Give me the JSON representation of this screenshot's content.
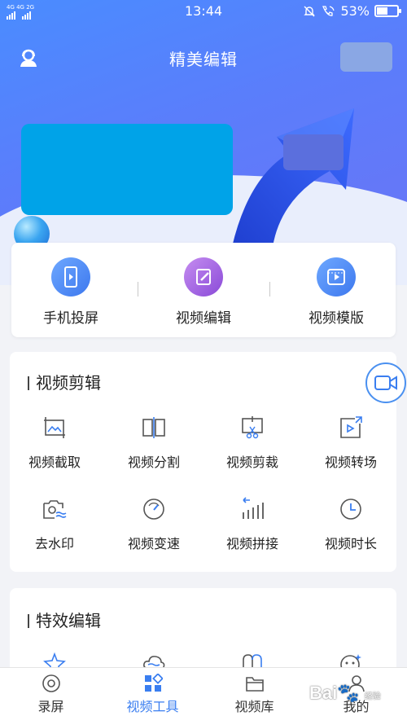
{
  "status_bar": {
    "signal_left": "4G 4G 2G",
    "time": "13:44",
    "battery": "53%"
  },
  "header": {
    "title": "精美编辑"
  },
  "quick_actions": [
    {
      "label": "手机投屏",
      "icon": "phone-cast-icon"
    },
    {
      "label": "视频编辑",
      "icon": "pencil-icon"
    },
    {
      "label": "视频模版",
      "icon": "video-template-icon"
    }
  ],
  "section_edit": {
    "title": "视频剪辑",
    "tools": [
      {
        "label": "视频截取",
        "icon": "crop-image-icon"
      },
      {
        "label": "视频分割",
        "icon": "split-icon"
      },
      {
        "label": "视频剪裁",
        "icon": "scissors-frame-icon"
      },
      {
        "label": "视频转场",
        "icon": "transition-icon"
      },
      {
        "label": "去水印",
        "icon": "camera-remove-watermark-icon"
      },
      {
        "label": "视频变速",
        "icon": "speedometer-icon"
      },
      {
        "label": "视频拼接",
        "icon": "join-bars-icon"
      },
      {
        "label": "视频时长",
        "icon": "clock-icon"
      }
    ]
  },
  "section_effects": {
    "title": "特效编辑",
    "tools": [
      {
        "icon": "star-effect-icon"
      },
      {
        "icon": "cloud-effect-icon"
      },
      {
        "icon": "mirror-effect-icon"
      },
      {
        "icon": "face-effect-icon"
      }
    ]
  },
  "tab_bar": [
    {
      "label": "录屏",
      "icon": "record-icon",
      "active": false
    },
    {
      "label": "视频工具",
      "icon": "tools-grid-icon",
      "active": true
    },
    {
      "label": "视频库",
      "icon": "folder-icon",
      "active": false
    },
    {
      "label": "我的",
      "icon": "profile-icon",
      "active": false
    }
  ],
  "watermark": {
    "text": "Bai",
    "subtext": "经验"
  },
  "colors": {
    "accent": "#3a7ef0",
    "hero_start": "#4a8cff",
    "hero_end": "#6b74f6",
    "banner_placeholder": "#00a3e8"
  }
}
